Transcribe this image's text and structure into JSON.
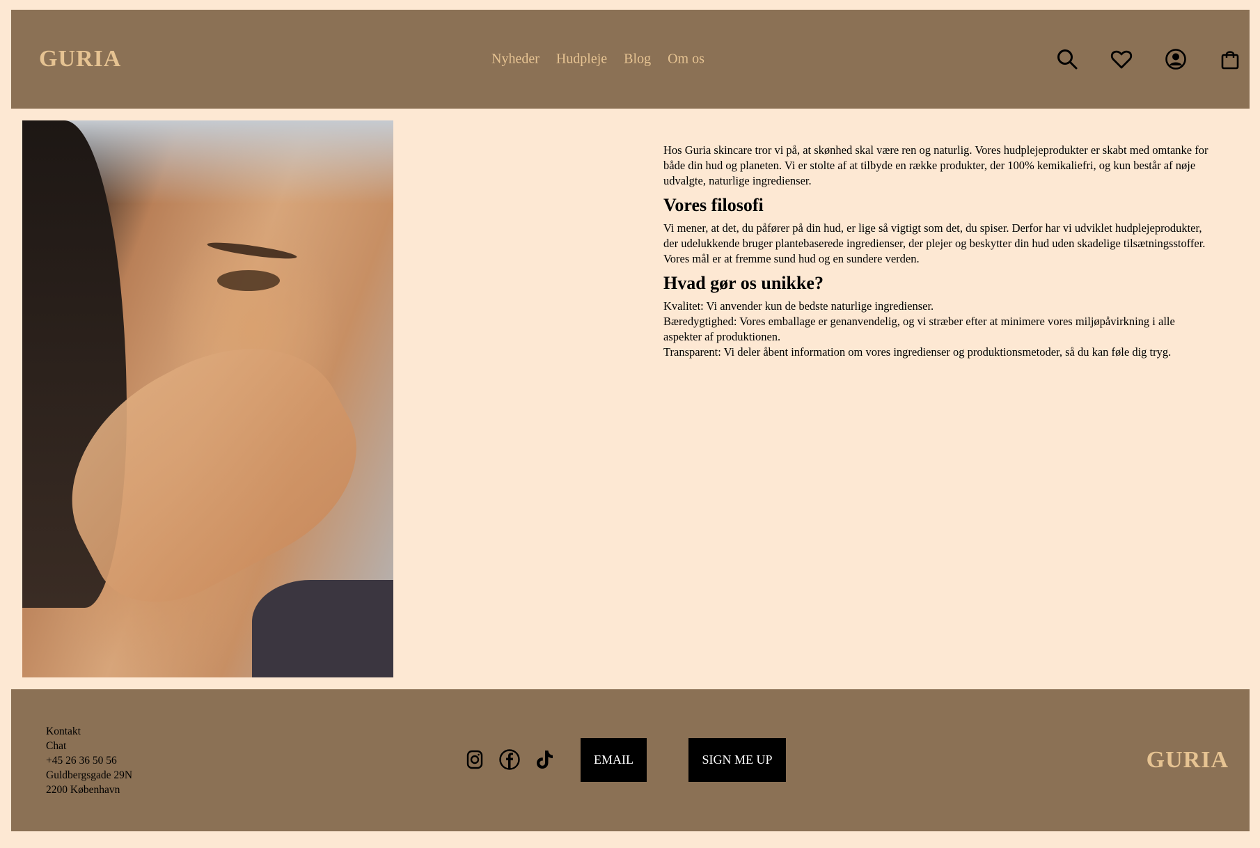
{
  "header": {
    "logo": "GURIA",
    "nav": [
      "Nyheder",
      "Hudpleje",
      "Blog",
      "Om os"
    ],
    "icons": [
      "search-icon",
      "heart-icon",
      "account-icon",
      "bag-icon"
    ]
  },
  "hero": {
    "image": "woman-washing-face-photo"
  },
  "content": {
    "intro": "Hos Guria skincare tror vi på, at skønhed skal være ren og naturlig. Vores hudplejeprodukter er skabt med omtanke for både din hud og planeten. Vi er stolte af at tilbyde en række produkter, der 100% kemikaliefri, og kun består af nøje udvalgte, naturlige ingredienser.",
    "philosophy_title": "Vores filosofi",
    "philosophy_text": "Vi mener, at det, du påfører på din hud, er lige så vigtigt som det, du spiser. Derfor har vi udviklet hudplejeprodukter, der udelukkende bruger plantebaserede ingredienser, der plejer og beskytter din hud uden skadelige tilsætningsstoffer. Vores mål er at fremme sund hud og en sundere verden.",
    "unique_title": "Hvad gør os unikke?",
    "unique_items": [
      "Kvalitet: Vi anvender kun de bedste naturlige ingredienser.",
      "Bæredygtighed: Vores emballage er genanvendelig, og vi stræber efter at minimere vores miljøpåvirkning i alle aspekter af produktionen.",
      "Transparent: Vi deler åbent information om vores ingredienser og produktionsmetoder, så du kan føle dig tryg."
    ]
  },
  "footer": {
    "contact": [
      "Kontakt",
      "Chat",
      "+45 26 36 50 56",
      "Guldbergsgade 29N",
      "2200 København"
    ],
    "socials": [
      "instagram-icon",
      "facebook-icon",
      "tiktok-icon"
    ],
    "email_button": "EMAIL",
    "signup_button": "SIGN ME UP",
    "logo": "GURIA"
  },
  "colors": {
    "bar": "#8b7155",
    "background": "#fde8d3",
    "logo": "#e6c392"
  }
}
